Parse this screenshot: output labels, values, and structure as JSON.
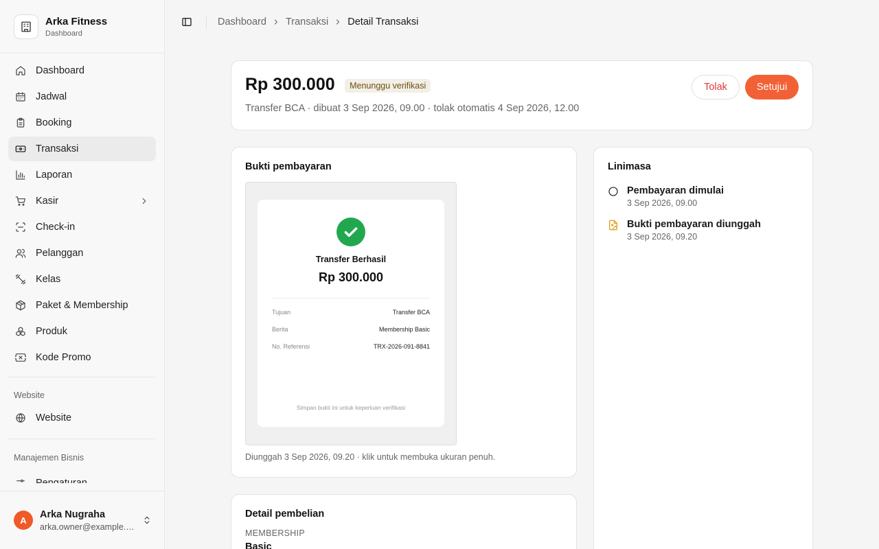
{
  "brand": {
    "name": "Arka Fitness",
    "subtitle": "Dashboard"
  },
  "sidebar": {
    "items": [
      {
        "label": "Dashboard",
        "icon": "home-icon"
      },
      {
        "label": "Jadwal",
        "icon": "calendar-icon"
      },
      {
        "label": "Booking",
        "icon": "clipboard-icon"
      },
      {
        "label": "Transaksi",
        "icon": "banknote-icon",
        "active": true
      },
      {
        "label": "Laporan",
        "icon": "bar-chart-icon"
      },
      {
        "label": "Kasir",
        "icon": "cart-icon",
        "expandable": true
      },
      {
        "label": "Check-in",
        "icon": "scan-icon"
      },
      {
        "label": "Pelanggan",
        "icon": "users-icon"
      },
      {
        "label": "Kelas",
        "icon": "dumbbell-icon"
      },
      {
        "label": "Paket & Membership",
        "icon": "package-icon"
      },
      {
        "label": "Produk",
        "icon": "boxes-icon"
      },
      {
        "label": "Kode Promo",
        "icon": "ticket-icon"
      }
    ],
    "groups": [
      {
        "label": "Website",
        "items": [
          {
            "label": "Website",
            "icon": "globe-icon"
          }
        ]
      },
      {
        "label": "Manajemen Bisnis",
        "items": [
          {
            "label": "Pengaturan",
            "icon": "settings-icon"
          }
        ]
      }
    ]
  },
  "user": {
    "initial": "A",
    "name": "Arka Nugraha",
    "email": "arka.owner@example.com"
  },
  "breadcrumb": [
    "Dashboard",
    "Transaksi",
    "Detail Transaksi"
  ],
  "transaction": {
    "amount": "Rp 300.000",
    "status": "Menunggu verifikasi",
    "meta": "Transfer BCA · dibuat 3 Sep 2026, 09.00 · tolak otomatis 4 Sep 2026, 12.00",
    "reject_label": "Tolak",
    "approve_label": "Setujui"
  },
  "proof": {
    "title": "Bukti pembayaran",
    "receipt": {
      "title": "Transfer Berhasil",
      "amount": "Rp 300.000",
      "rows": [
        {
          "label": "Tujuan",
          "value": "Transfer BCA"
        },
        {
          "label": "Berita",
          "value": "Membership Basic"
        },
        {
          "label": "No. Referensi",
          "value": "TRX-2026-091-8841"
        }
      ],
      "footer": "Simpan bukti ini untuk keperluan verifikasi"
    },
    "caption": "Diunggah 3 Sep 2026, 09.20 · klik untuk membuka ukuran penuh."
  },
  "timeline": {
    "title": "Linimasa",
    "items": [
      {
        "title": "Pembayaran dimulai",
        "time": "3 Sep 2026, 09.00",
        "icon": "circle-icon"
      },
      {
        "title": "Bukti pembayaran diunggah",
        "time": "3 Sep 2026, 09.20",
        "icon": "file-image-icon",
        "color": "#e0a020"
      }
    ]
  },
  "purchase": {
    "title": "Detail pembelian",
    "type_label": "MEMBERSHIP",
    "plan": "Basic"
  },
  "colors": {
    "accent": "#f26135",
    "success": "#21a84e",
    "danger": "#e0393e"
  }
}
